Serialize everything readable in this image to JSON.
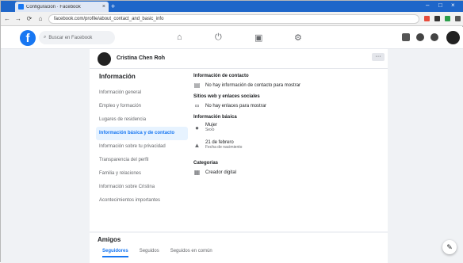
{
  "browser": {
    "tab_title": "Configuración · Facebook",
    "tab_close": "×",
    "new_tab": "+",
    "window_controls": [
      "–",
      "□",
      "×"
    ],
    "nav": {
      "back": "←",
      "forward": "→",
      "reload": "⟳",
      "home": "⌂"
    },
    "url": "facebook.com/profile/about_contact_and_basic_info"
  },
  "fbnav": {
    "logo": "f",
    "search_placeholder": "Buscar en Facebook",
    "center_icons": [
      "home-icon",
      "watch-icon",
      "marketplace-icon",
      "groups-icon"
    ],
    "right_icons": [
      "menu-icon",
      "messenger-icon",
      "notifications-icon",
      "account-icon"
    ]
  },
  "profile": {
    "name": "Cristina Chen Roh",
    "more_label": "···"
  },
  "info_menu": {
    "title": "Información",
    "items": [
      {
        "label": "Información general",
        "active": false
      },
      {
        "label": "Empleo y formación",
        "active": false
      },
      {
        "label": "Lugares de residencia",
        "active": false
      },
      {
        "label": "Información básica y de contacto",
        "active": true
      },
      {
        "label": "Información sobre tu privacidad",
        "active": false
      },
      {
        "label": "Transparencia del perfil",
        "active": false
      },
      {
        "label": "Familia y relaciones",
        "active": false
      },
      {
        "label": "Información sobre Cristina",
        "active": false
      },
      {
        "label": "Acontecimientos importantes",
        "active": false
      }
    ]
  },
  "details": {
    "contact_title": "Información de contacto",
    "contact_value": "No hay información de contacto para mostrar",
    "websites_title": "Sitios web y enlaces sociales",
    "websites_value": "No hay enlaces para mostrar",
    "basic_title": "Información básica",
    "gender_value": "Mujer",
    "gender_label": "Sexo",
    "birthday_value": "21 de febrero",
    "birthday_label": "Fecha de nacimiento",
    "categories_title": "Categorías",
    "categories_value": "Creador digital"
  },
  "friends": {
    "title": "Amigos",
    "tabs": [
      {
        "label": "Seguidores",
        "active": true
      },
      {
        "label": "Seguidos",
        "active": false
      },
      {
        "label": "Seguidos en común",
        "active": false
      }
    ]
  },
  "floating": {
    "messages_icon": "✎"
  },
  "colors": {
    "brand": "#1877f2",
    "tabbar": "#1e66c9",
    "active_bg": "#e7f3ff"
  }
}
